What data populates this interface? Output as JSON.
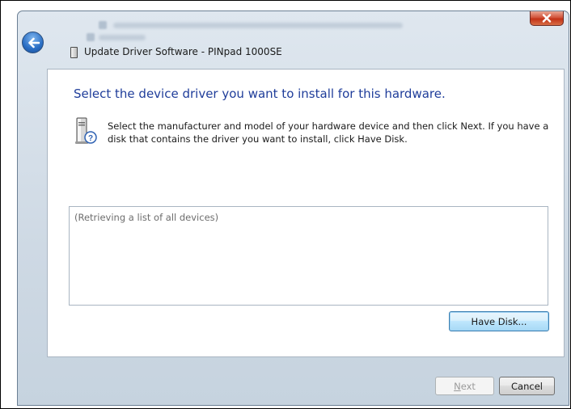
{
  "window": {
    "title": "Update Driver Software - PINpad 1000SE"
  },
  "content": {
    "heading": "Select the device driver you want to install for this hardware.",
    "instructions": "Select the manufacturer and model of your hardware device and then click Next. If you have a disk that contains the driver you want to install, click Have Disk.",
    "list_status": "(Retrieving a list of all devices)"
  },
  "buttons": {
    "have_disk": "Have Disk...",
    "next_mnemonic": "N",
    "next_rest": "ext",
    "cancel": "Cancel"
  },
  "icons": {
    "close": "close-icon",
    "back": "back-arrow-icon",
    "device": "device-icon",
    "hardware_help": "hardware-help-icon"
  },
  "colors": {
    "heading": "#1f3d9a",
    "close_button": "#c23217",
    "have_disk_border": "#3c7fb1"
  }
}
